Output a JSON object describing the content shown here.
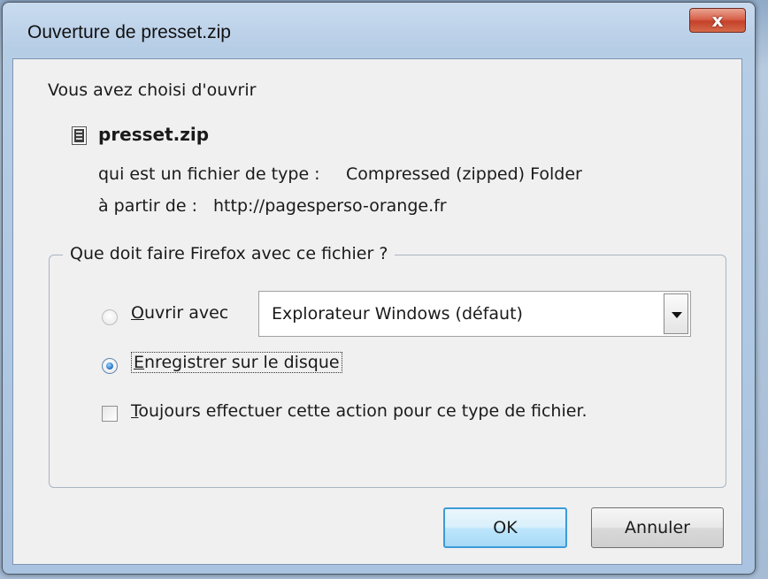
{
  "dialog": {
    "title": "Ouverture de presset.zip",
    "close_label": "x"
  },
  "content": {
    "intro": "Vous avez choisi d'ouvrir",
    "file_icon": "zip-file-icon",
    "filename": "presset.zip",
    "type_label": "qui est un fichier de type :",
    "type_value": "Compressed (zipped) Folder",
    "from_label": "à partir de :",
    "from_value": "http://pagesperso-orange.fr"
  },
  "action_group": {
    "legend": "Que doit faire Firefox avec ce fichier ?",
    "open_with": {
      "label_underlined_char": "O",
      "label_rest": "uvrir avec",
      "selected": false,
      "app_value": "Explorateur Windows (défaut)"
    },
    "save": {
      "label_underlined_char": "E",
      "label_rest": "nregistrer sur le disque",
      "selected": true
    },
    "always": {
      "label_underlined_char": "T",
      "label_rest": "oujours effectuer cette action pour ce type de fichier.",
      "checked": false
    }
  },
  "buttons": {
    "ok": "OK",
    "cancel": "Annuler"
  },
  "colors": {
    "title_bar": "#b6cde6",
    "close_button": "#c4412a",
    "client_bg": "#f0f0f0",
    "ok_focus_border": "#3c9bd8"
  }
}
